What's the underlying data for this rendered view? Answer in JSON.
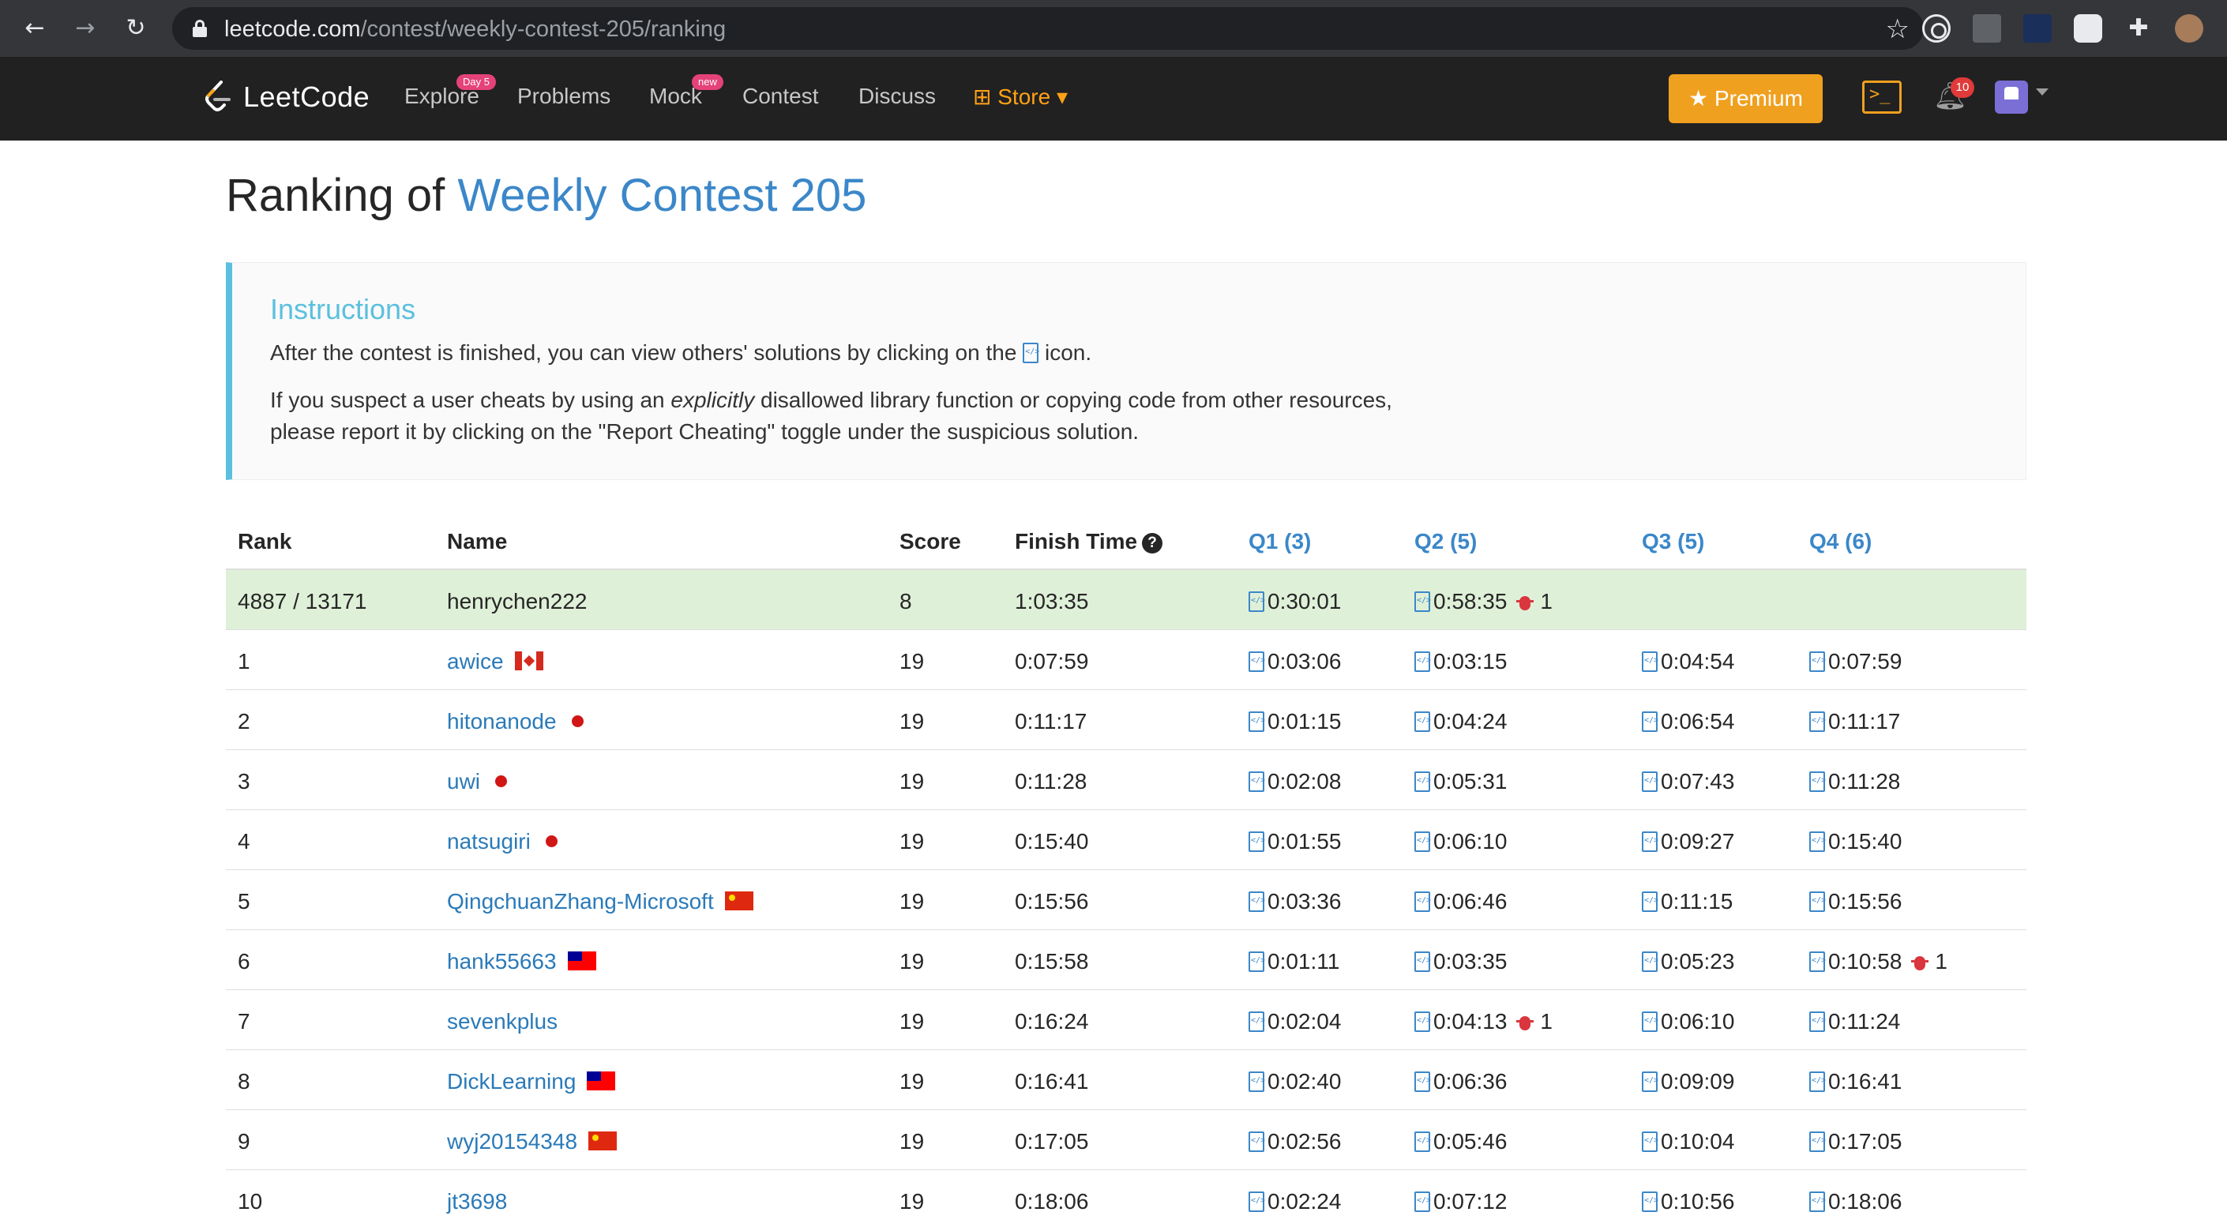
{
  "browser": {
    "url_host": "leetcode.com",
    "url_path": "/contest/weekly-contest-205/ranking",
    "icons": [
      "back-icon",
      "forward-icon",
      "reload-icon",
      "lock-icon",
      "bookmark-star-icon",
      "extension-icon",
      "puzzle-icon",
      "profile-avatar"
    ]
  },
  "nav": {
    "logo_text": "LeetCode",
    "links": [
      {
        "label": "Explore",
        "badge": "Day 5"
      },
      {
        "label": "Problems",
        "badge": ""
      },
      {
        "label": "Mock",
        "badge": "new"
      },
      {
        "label": "Contest",
        "badge": ""
      },
      {
        "label": "Discuss",
        "badge": ""
      }
    ],
    "store_label": "Store",
    "premium_label": "Premium",
    "notification_count": "10",
    "colors": {
      "premium": "#f0a01f",
      "badge": "#e5427a",
      "store": "#ffa116"
    }
  },
  "page": {
    "title_prefix": "Ranking of ",
    "title_contest": "Weekly Contest 205"
  },
  "instructions": {
    "title": "Instructions",
    "line1_a": "After the contest is finished, you can view others' solutions by clicking on the",
    "line1_b": "icon.",
    "line2_a": "If you suspect a user cheats by using an ",
    "line2_em": "explicitly",
    "line2_b": " disallowed library function or copying code from other resources,",
    "line3": "please report it by clicking on the \"Report Cheating\" toggle under the suspicious solution."
  },
  "table": {
    "headers": {
      "rank": "Rank",
      "name": "Name",
      "score": "Score",
      "finish": "Finish Time",
      "q1": "Q1 (3)",
      "q2": "Q2 (5)",
      "q3": "Q3 (5)",
      "q4": "Q4 (6)"
    },
    "my_row": {
      "rank": "4887 / 13171",
      "name": "henrychen222",
      "score": "8",
      "finish": "1:03:35",
      "q1": "0:30:01",
      "q2": "0:58:35",
      "q2_bugs": "1",
      "q3": "",
      "q4": ""
    },
    "rows": [
      {
        "rank": "1",
        "name": "awice",
        "flag": "ca",
        "score": "19",
        "finish": "0:07:59",
        "q1": "0:03:06",
        "q2": "0:03:15",
        "q3": "0:04:54",
        "q4": "0:07:59"
      },
      {
        "rank": "2",
        "name": "hitonanode",
        "flag": "jp",
        "score": "19",
        "finish": "0:11:17",
        "q1": "0:01:15",
        "q2": "0:04:24",
        "q3": "0:06:54",
        "q4": "0:11:17"
      },
      {
        "rank": "3",
        "name": "uwi",
        "flag": "jp",
        "score": "19",
        "finish": "0:11:28",
        "q1": "0:02:08",
        "q2": "0:05:31",
        "q3": "0:07:43",
        "q4": "0:11:28"
      },
      {
        "rank": "4",
        "name": "natsugiri",
        "flag": "jp",
        "score": "19",
        "finish": "0:15:40",
        "q1": "0:01:55",
        "q2": "0:06:10",
        "q3": "0:09:27",
        "q4": "0:15:40"
      },
      {
        "rank": "5",
        "name": "QingchuanZhang-Microsoft",
        "flag": "cn",
        "score": "19",
        "finish": "0:15:56",
        "q1": "0:03:36",
        "q2": "0:06:46",
        "q3": "0:11:15",
        "q4": "0:15:56"
      },
      {
        "rank": "6",
        "name": "hank55663",
        "flag": "tw",
        "score": "19",
        "finish": "0:15:58",
        "q1": "0:01:11",
        "q2": "0:03:35",
        "q3": "0:05:23",
        "q4": "0:10:58",
        "q4_bugs": "1"
      },
      {
        "rank": "7",
        "name": "sevenkplus",
        "flag": "",
        "score": "19",
        "finish": "0:16:24",
        "q1": "0:02:04",
        "q2": "0:04:13",
        "q2_bugs": "1",
        "q3": "0:06:10",
        "q4": "0:11:24"
      },
      {
        "rank": "8",
        "name": "DickLearning",
        "flag": "tw",
        "score": "19",
        "finish": "0:16:41",
        "q1": "0:02:40",
        "q2": "0:06:36",
        "q3": "0:09:09",
        "q4": "0:16:41"
      },
      {
        "rank": "9",
        "name": "wyj20154348",
        "flag": "cn",
        "score": "19",
        "finish": "0:17:05",
        "q1": "0:02:56",
        "q2": "0:05:46",
        "q3": "0:10:04",
        "q4": "0:17:05"
      },
      {
        "rank": "10",
        "name": "jt3698",
        "flag": "",
        "score": "19",
        "finish": "0:18:06",
        "q1": "0:02:24",
        "q2": "0:07:12",
        "q3": "0:10:56",
        "q4": "0:18:06"
      }
    ]
  }
}
